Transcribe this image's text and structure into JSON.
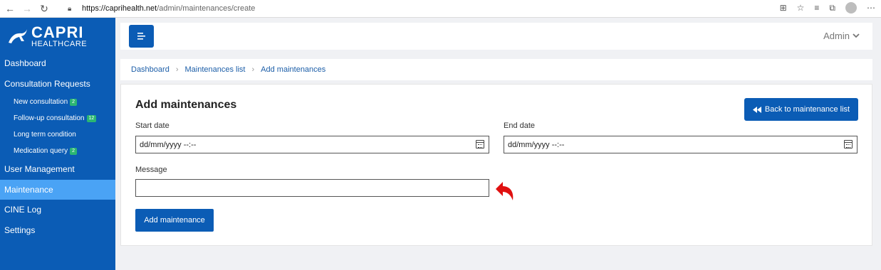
{
  "browser": {
    "url_host": "https://caprihealth.net",
    "url_path": "/admin/maintenances/create"
  },
  "logo": {
    "line1": "CAPRI",
    "line2": "HEALTHCARE"
  },
  "sidebar": {
    "items": [
      {
        "label": "Dashboard"
      },
      {
        "label": "Consultation Requests"
      },
      {
        "label": "New consultation",
        "badge": "2"
      },
      {
        "label": "Follow-up consultation",
        "badge": "12"
      },
      {
        "label": "Long term condition"
      },
      {
        "label": "Medication query",
        "badge": "2"
      },
      {
        "label": "User Management"
      },
      {
        "label": "Maintenance"
      },
      {
        "label": "CINE Log"
      },
      {
        "label": "Settings"
      }
    ]
  },
  "header": {
    "user": "Admin"
  },
  "breadcrumb": [
    "Dashboard",
    "Maintenances list",
    "Add maintenances"
  ],
  "form": {
    "title": "Add maintenances",
    "back_button": "Back to maintenance list",
    "start_label": "Start date",
    "start_value": "dd/mm/yyyy --:--",
    "end_label": "End date",
    "end_value": "dd/mm/yyyy --:--",
    "message_label": "Message",
    "message_value": "",
    "submit": "Add maintenance"
  },
  "colors": {
    "primary": "#0b5cb5",
    "active": "#4aa3f5",
    "badge": "#2bb673",
    "annotation": "#e01010"
  }
}
